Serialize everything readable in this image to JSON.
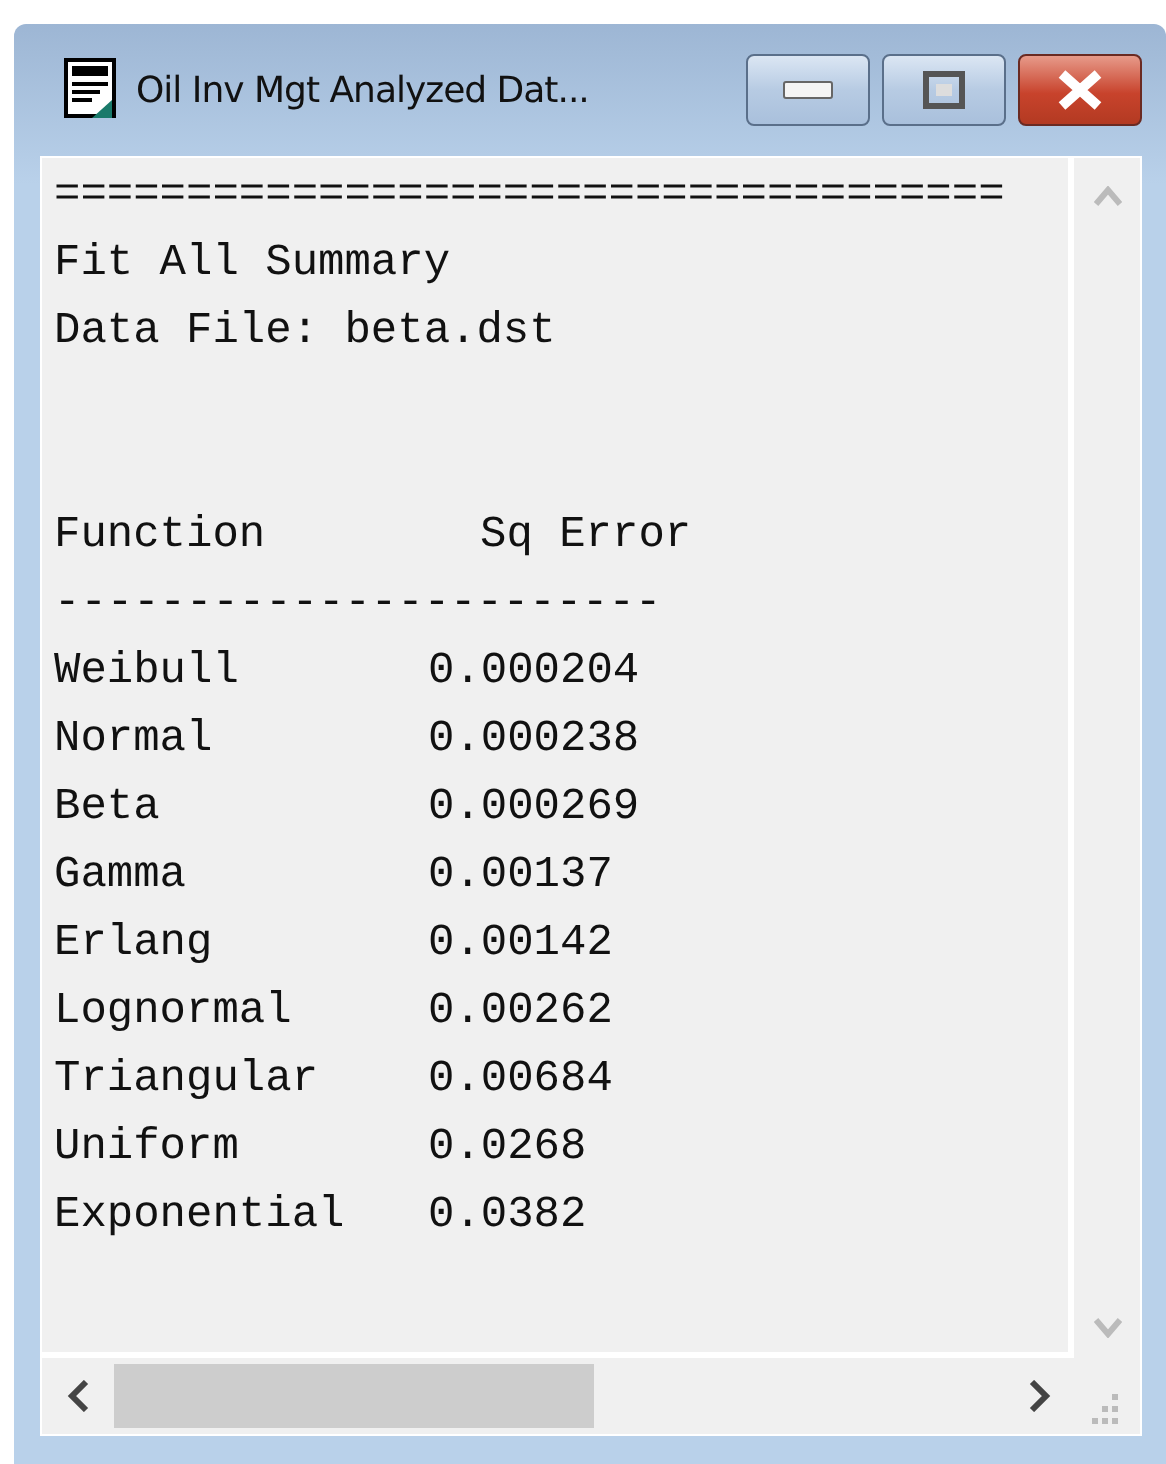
{
  "window": {
    "title": "Oil Inv Mgt Analyzed Dat..."
  },
  "report": {
    "lines": [
      "====================================",
      "Fit All Summary",
      "Data File: beta.dst"
    ],
    "columns": [
      "Function",
      "Sq Error"
    ],
    "rule": "-----------------------",
    "rows": [
      {
        "function": "Weibull",
        "sq_error": "0.000204"
      },
      {
        "function": "Normal",
        "sq_error": "0.000238"
      },
      {
        "function": "Beta",
        "sq_error": "0.000269"
      },
      {
        "function": "Gamma",
        "sq_error": "0.00137"
      },
      {
        "function": "Erlang",
        "sq_error": "0.00142"
      },
      {
        "function": "Lognormal",
        "sq_error": "0.00262"
      },
      {
        "function": "Triangular",
        "sq_error": "0.00684"
      },
      {
        "function": "Uniform",
        "sq_error": "0.0268"
      },
      {
        "function": "Exponential",
        "sq_error": "0.0382"
      }
    ]
  }
}
